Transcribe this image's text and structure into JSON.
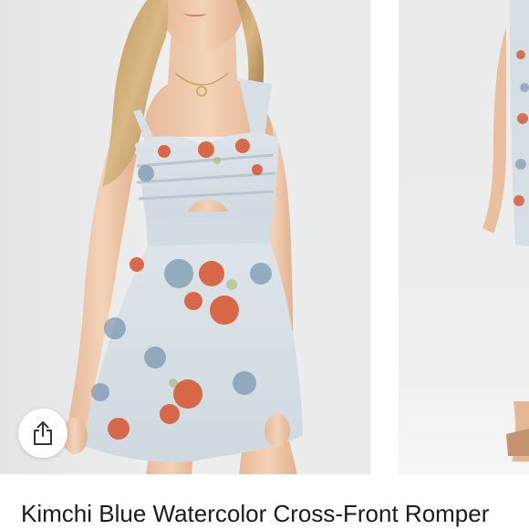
{
  "gallery": {
    "main_image_icon": "model-wearing-floral-romper",
    "next_image_icon": "model-full-length-romper-side"
  },
  "actions": {
    "share_icon": "share-icon"
  },
  "listing": {
    "title": "Kimchi Blue Watercolor Cross-Front Romper"
  },
  "colors": {
    "romper_base": "#dfe6ea",
    "floral_red": "#d9532e",
    "floral_blue": "#5a7e9c",
    "skin": "#f0c9a8",
    "hair": "#c9a36b"
  }
}
